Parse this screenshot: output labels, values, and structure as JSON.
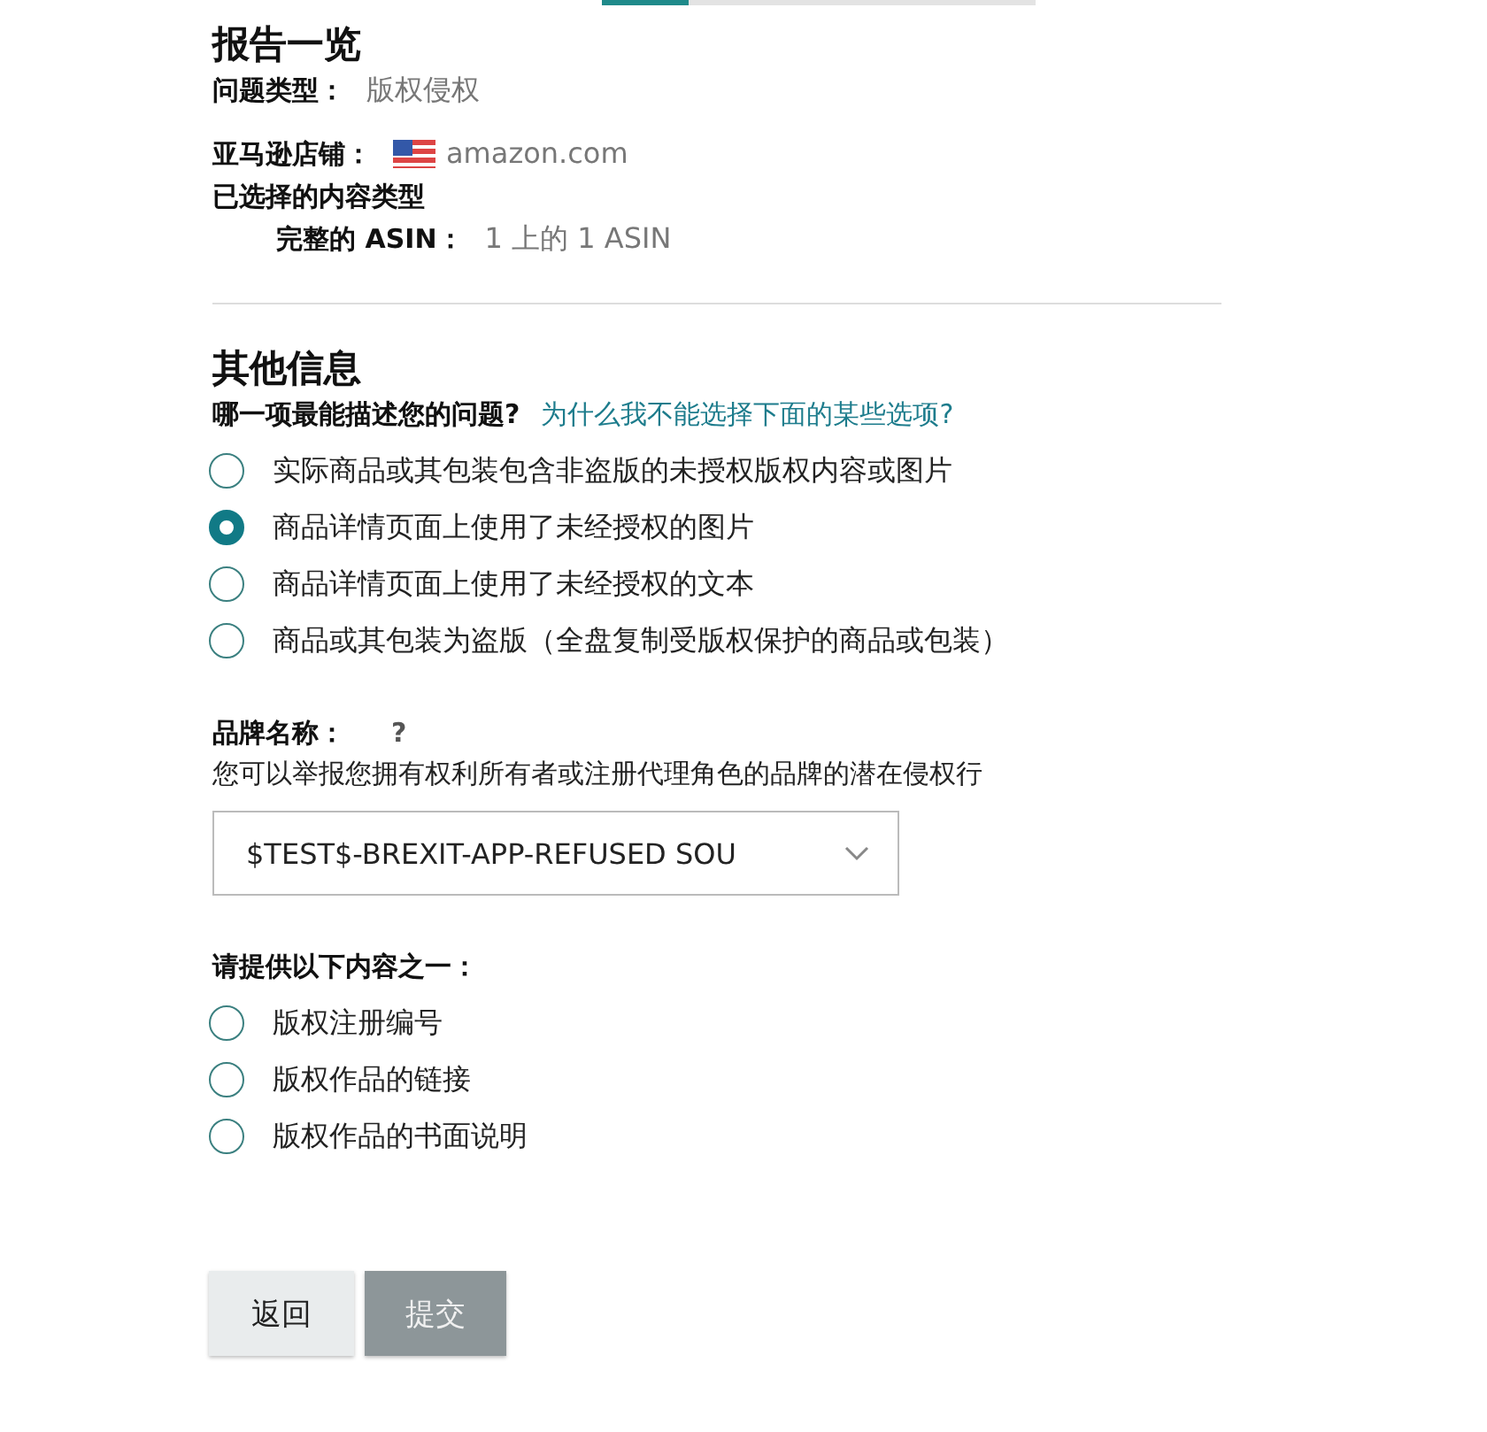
{
  "progress": {
    "level": 0.2
  },
  "summary": {
    "title": "报告一览",
    "issue_label": "问题类型：",
    "issue_value": "版权侵权",
    "store_label": "亚马逊店铺：",
    "store_value": "amazon.com",
    "content_label": "已选择的内容类型",
    "asin_label": "完整的 ASIN：",
    "asin_value": "1 上的 1 ASIN"
  },
  "other": {
    "title": "其他信息",
    "question": "哪一项最能描述您的问题?",
    "help_link": "为什么我不能选择下面的某些选项?",
    "options": [
      {
        "label": "实际商品或其包装包含非盗版的未授权版权内容或图片",
        "selected": false
      },
      {
        "label": "商品详情页面上使用了未经授权的图片",
        "selected": true
      },
      {
        "label": "商品详情页面上使用了未经授权的文本",
        "selected": false
      },
      {
        "label": "商品或其包装为盗版（全盘复制受版权保护的商品或包装）",
        "selected": false
      }
    ]
  },
  "brand": {
    "label": "品牌名称：",
    "help": "?",
    "hint": "您可以举报您拥有权利所有者或注册代理角色的品牌的潜在侵权行",
    "value": "$TEST$-BREXIT-APP-REFUSED SOU"
  },
  "provide": {
    "title": "请提供以下内容之一：",
    "options": [
      {
        "label": "版权注册编号",
        "selected": false
      },
      {
        "label": "版权作品的链接",
        "selected": false
      },
      {
        "label": "版权作品的书面说明",
        "selected": false
      }
    ]
  },
  "buttons": [
    {
      "label": "返回",
      "disabled": false
    },
    {
      "label": "提交",
      "disabled": true
    }
  ]
}
